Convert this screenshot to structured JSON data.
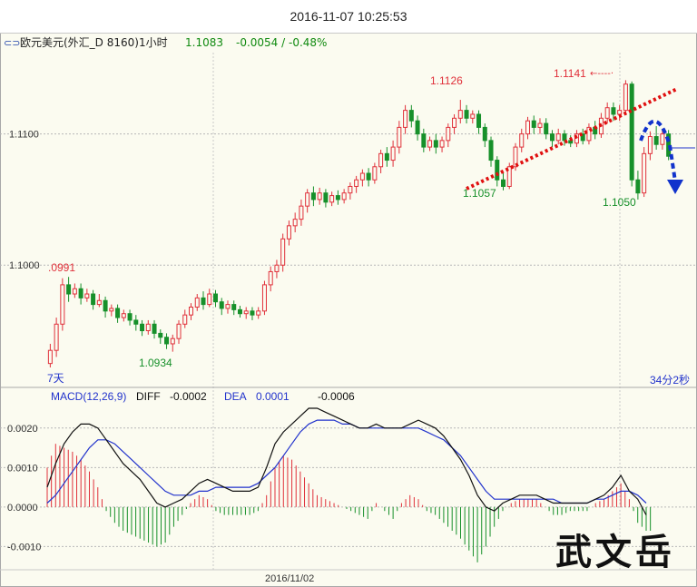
{
  "window": {
    "title": "2016-11-07 10:25:53"
  },
  "info": {
    "menu_icon": "menu-icon",
    "symbol_label": "欧元美元(外汇_D 8160)1小时",
    "last_price": "1.1083",
    "change": "-0.0054 / -0.48%"
  },
  "colors": {
    "up": "#e0303a",
    "down": "#17902a",
    "diff": "#111111",
    "dea": "#2233cc",
    "trend_red": "#e01010",
    "arrow_blue": "#1133cc"
  },
  "annotations": {
    "high_label_1": "1.1126",
    "high_label_2": "1.1141",
    "left_label": ".0991",
    "low_label_1": "1.0934",
    "low_label_2": "1.1057",
    "low_label_3": "1.1050",
    "bottom_left_tag": "7天",
    "timer": "34分2秒"
  },
  "macd": {
    "label": "MACD(12,26,9)",
    "diff_label": "DIFF",
    "diff_value": "-0.0002",
    "dea_label": "DEA",
    "dea_value": "0.0001",
    "macd_value": "-0.0006"
  },
  "x_axis": {
    "date_label": "2016/11/02"
  },
  "watermark": "武文岳",
  "chart_data": [
    {
      "type": "candlestick",
      "title": "",
      "ylabel": "",
      "y_ticks": [
        "1.1100",
        "1.1000"
      ],
      "ylim": [
        1.0913,
        1.1162
      ],
      "grid": true,
      "candles": [
        [
          1.0925,
          1.0935,
          1.0922,
          1.094
        ],
        [
          1.0935,
          1.0955,
          1.093,
          1.096
        ],
        [
          1.0955,
          1.0985,
          1.095,
          1.099
        ],
        [
          1.0985,
          1.0978,
          1.0972,
          1.0991
        ],
        [
          1.0978,
          1.0982,
          1.0975,
          1.0986
        ],
        [
          1.0982,
          1.0975,
          1.097,
          1.0986
        ],
        [
          1.0975,
          1.0978,
          1.0972,
          1.0982
        ],
        [
          1.0978,
          1.097,
          1.0966,
          1.0981
        ],
        [
          1.097,
          1.0973,
          1.0968,
          1.0978
        ],
        [
          1.0973,
          1.0965,
          1.096,
          1.0976
        ],
        [
          1.0965,
          1.0967,
          1.0961,
          1.097
        ],
        [
          1.0967,
          1.096,
          1.0956,
          1.097
        ],
        [
          1.096,
          1.0963,
          1.0957,
          1.0966
        ],
        [
          1.0963,
          1.0958,
          1.0954,
          1.0966
        ],
        [
          1.0958,
          1.0955,
          1.095,
          1.0962
        ],
        [
          1.0955,
          1.095,
          1.0946,
          1.0958
        ],
        [
          1.095,
          1.0955,
          1.0947,
          1.0958
        ],
        [
          1.0955,
          1.0948,
          1.0944,
          1.0958
        ],
        [
          1.0948,
          1.0945,
          1.094,
          1.0951
        ],
        [
          1.0945,
          1.094,
          1.0936,
          1.0948
        ],
        [
          1.094,
          1.0944,
          1.0934,
          1.0947
        ],
        [
          1.0944,
          1.0955,
          1.094,
          1.0958
        ],
        [
          1.0955,
          1.0962,
          1.0952,
          1.0966
        ],
        [
          1.0962,
          1.0968,
          1.0958,
          1.0971
        ],
        [
          1.0968,
          1.0975,
          1.0965,
          1.0978
        ],
        [
          1.0975,
          1.097,
          1.0966,
          1.098
        ],
        [
          1.097,
          1.0978,
          1.0968,
          1.0982
        ],
        [
          1.0978,
          1.0972,
          1.0968,
          1.0981
        ],
        [
          1.0972,
          1.0967,
          1.0962,
          1.0975
        ],
        [
          1.0967,
          1.097,
          1.0963,
          1.0973
        ],
        [
          1.097,
          1.0966,
          1.0962,
          1.0973
        ],
        [
          1.0966,
          1.0963,
          1.096,
          1.0969
        ],
        [
          1.0963,
          1.0965,
          1.0959,
          1.0968
        ],
        [
          1.0965,
          1.0962,
          1.0958,
          1.0968
        ],
        [
          1.0962,
          1.0965,
          1.0959,
          1.0968
        ],
        [
          1.0965,
          1.0985,
          1.0962,
          1.0988
        ],
        [
          1.0985,
          1.0995,
          1.098,
          1.0999
        ],
        [
          1.0995,
          1.1,
          1.099,
          1.1004
        ],
        [
          1.1,
          1.102,
          1.0995,
          1.1024
        ],
        [
          1.102,
          1.103,
          1.1015,
          1.1034
        ],
        [
          1.103,
          1.1035,
          1.1025,
          1.104
        ],
        [
          1.1035,
          1.1045,
          1.103,
          1.105
        ],
        [
          1.1045,
          1.1055,
          1.104,
          1.1058
        ],
        [
          1.1055,
          1.105,
          1.1045,
          1.106
        ],
        [
          1.105,
          1.1055,
          1.1046,
          1.1059
        ],
        [
          1.1055,
          1.1048,
          1.1044,
          1.1058
        ],
        [
          1.1048,
          1.1053,
          1.1045,
          1.1056
        ],
        [
          1.1053,
          1.105,
          1.1046,
          1.1057
        ],
        [
          1.105,
          1.1055,
          1.1047,
          1.1058
        ],
        [
          1.1055,
          1.106,
          1.105,
          1.1063
        ],
        [
          1.106,
          1.1065,
          1.1055,
          1.1068
        ],
        [
          1.1065,
          1.107,
          1.106,
          1.1073
        ],
        [
          1.107,
          1.1065,
          1.106,
          1.1074
        ],
        [
          1.1065,
          1.1075,
          1.1062,
          1.1078
        ],
        [
          1.1075,
          1.1085,
          1.107,
          1.1088
        ],
        [
          1.1085,
          1.108,
          1.1075,
          1.109
        ],
        [
          1.108,
          1.109,
          1.1075,
          1.1095
        ],
        [
          1.109,
          1.1105,
          1.1085,
          1.111
        ],
        [
          1.1105,
          1.1118,
          1.11,
          1.1122
        ],
        [
          1.1118,
          1.111,
          1.1105,
          1.1122
        ],
        [
          1.111,
          1.11,
          1.1095,
          1.1114
        ],
        [
          1.11,
          1.109,
          1.1086,
          1.1104
        ],
        [
          1.109,
          1.1095,
          1.1087,
          1.1098
        ],
        [
          1.1095,
          1.109,
          1.1085,
          1.11
        ],
        [
          1.109,
          1.1095,
          1.1086,
          1.1098
        ],
        [
          1.1095,
          1.1105,
          1.109,
          1.1108
        ],
        [
          1.1105,
          1.1112,
          1.11,
          1.1115
        ],
        [
          1.1112,
          1.1118,
          1.1108,
          1.1126
        ],
        [
          1.1118,
          1.1112,
          1.1108,
          1.1122
        ],
        [
          1.1112,
          1.1115,
          1.1108,
          1.1118
        ],
        [
          1.1115,
          1.1105,
          1.11,
          1.1118
        ],
        [
          1.1105,
          1.1095,
          1.109,
          1.1108
        ],
        [
          1.1095,
          1.108,
          1.1075,
          1.1098
        ],
        [
          1.108,
          1.1065,
          1.106,
          1.1083
        ],
        [
          1.1065,
          1.106,
          1.1057,
          1.107
        ],
        [
          1.106,
          1.1075,
          1.1058,
          1.1078
        ],
        [
          1.1075,
          1.109,
          1.1072,
          1.1093
        ],
        [
          1.109,
          1.11,
          1.1086,
          1.1104
        ],
        [
          1.11,
          1.111,
          1.1096,
          1.1113
        ],
        [
          1.111,
          1.1105,
          1.11,
          1.1114
        ],
        [
          1.1105,
          1.1108,
          1.11,
          1.1112
        ],
        [
          1.1108,
          1.11,
          1.1096,
          1.1112
        ],
        [
          1.11,
          1.1095,
          1.109,
          1.1103
        ],
        [
          1.1095,
          1.11,
          1.1092,
          1.1104
        ],
        [
          1.11,
          1.1095,
          1.1091,
          1.1103
        ],
        [
          1.1095,
          1.1093,
          1.109,
          1.1099
        ],
        [
          1.1093,
          1.11,
          1.109,
          1.1103
        ],
        [
          1.11,
          1.1095,
          1.1092,
          1.1104
        ],
        [
          1.1095,
          1.1105,
          1.1092,
          1.1108
        ],
        [
          1.1105,
          1.11,
          1.1096,
          1.111
        ],
        [
          1.11,
          1.1112,
          1.1097,
          1.1116
        ],
        [
          1.1112,
          1.112,
          1.1108,
          1.1124
        ],
        [
          1.112,
          1.1115,
          1.111,
          1.1124
        ],
        [
          1.1115,
          1.1118,
          1.111,
          1.1122
        ],
        [
          1.1118,
          1.1138,
          1.1115,
          1.1141
        ],
        [
          1.1138,
          1.1065,
          1.106,
          1.114
        ],
        [
          1.1065,
          1.1055,
          1.105,
          1.1072
        ],
        [
          1.1055,
          1.1085,
          1.1052,
          1.109
        ],
        [
          1.1085,
          1.1098,
          1.108,
          1.1102
        ],
        [
          1.1098,
          1.1092,
          1.1088,
          1.1106
        ],
        [
          1.1092,
          1.11,
          1.1088,
          1.1104
        ],
        [
          1.11,
          1.1083,
          1.108,
          1.1103
        ]
      ]
    },
    {
      "type": "macd",
      "yticks": [
        "0.0020",
        "0.0010",
        "0.0000",
        "-0.0010"
      ],
      "ylim": [
        -0.00145,
        0.0025
      ],
      "diff": [
        0.0005,
        0.0011,
        0.0016,
        0.0019,
        0.0021,
        0.0021,
        0.002,
        0.0017,
        0.0014,
        0.0011,
        0.0009,
        0.0007,
        0.0004,
        0.0001,
        0.0,
        0.0001,
        0.0002,
        0.0004,
        0.0006,
        0.0007,
        0.0006,
        0.0005,
        0.0004,
        0.0004,
        0.0004,
        0.0005,
        0.001,
        0.0016,
        0.0019,
        0.0021,
        0.0023,
        0.0025,
        0.0025,
        0.0024,
        0.0023,
        0.0022,
        0.0021,
        0.002,
        0.002,
        0.0021,
        0.002,
        0.002,
        0.002,
        0.0021,
        0.0022,
        0.0021,
        0.002,
        0.0018,
        0.0015,
        0.0012,
        0.0008,
        0.0003,
        0.0,
        -0.0001,
        0.0001,
        0.0002,
        0.0003,
        0.0003,
        0.0003,
        0.0002,
        0.0001,
        0.0001,
        0.0001,
        0.0001,
        0.0001,
        0.0002,
        0.0003,
        0.0005,
        0.0008,
        0.0004,
        0.0002,
        -0.0002
      ],
      "dea": [
        0.0001,
        0.0003,
        0.0006,
        0.0009,
        0.0012,
        0.0015,
        0.0017,
        0.0017,
        0.0016,
        0.0014,
        0.0012,
        0.001,
        0.0008,
        0.0006,
        0.0004,
        0.0003,
        0.0003,
        0.0003,
        0.0004,
        0.0004,
        0.0005,
        0.0005,
        0.0005,
        0.0005,
        0.0005,
        0.0006,
        0.0008,
        0.001,
        0.0013,
        0.0016,
        0.0019,
        0.0021,
        0.0022,
        0.0022,
        0.0022,
        0.0021,
        0.0021,
        0.002,
        0.002,
        0.002,
        0.002,
        0.002,
        0.002,
        0.002,
        0.002,
        0.0019,
        0.0018,
        0.0017,
        0.0015,
        0.0013,
        0.001,
        0.0007,
        0.0004,
        0.0002,
        0.0002,
        0.0002,
        0.0002,
        0.0002,
        0.0002,
        0.0002,
        0.0002,
        0.0001,
        0.0001,
        0.0001,
        0.0001,
        0.0002,
        0.0002,
        0.0003,
        0.0004,
        0.0004,
        0.0003,
        0.0001
      ],
      "hist": [
        0.001,
        0.0016,
        0.0015,
        0.0014,
        0.0012,
        0.0009,
        0.0005,
        -0.0001,
        -0.0004,
        -0.0006,
        -0.0007,
        -0.0008,
        -0.0009,
        -0.001,
        -0.0009,
        -0.0005,
        -0.0002,
        0.0001,
        0.0003,
        0.0002,
        -0.0001,
        -0.0002,
        -0.0002,
        -0.0002,
        -0.0002,
        -0.0001,
        0.0003,
        0.001,
        0.0013,
        0.0012,
        0.0009,
        0.0006,
        0.0003,
        0.0002,
        0.0001,
        0.0,
        -0.0001,
        -0.0002,
        -0.0003,
        0.0001,
        -0.0001,
        -0.0003,
        0.0001,
        0.0003,
        0.0002,
        -0.0001,
        -0.0002,
        -0.0004,
        -0.0006,
        -0.0008,
        -0.0011,
        -0.0014,
        -0.001,
        -0.0005,
        -0.0001,
        0.0001,
        0.0002,
        0.0002,
        0.0002,
        0.0,
        -0.0002,
        -0.0002,
        -0.0001,
        -0.0001,
        -0.0001,
        0.0001,
        0.0002,
        0.0004,
        0.0006,
        0.0002,
        -0.0004,
        -0.0006
      ]
    }
  ]
}
